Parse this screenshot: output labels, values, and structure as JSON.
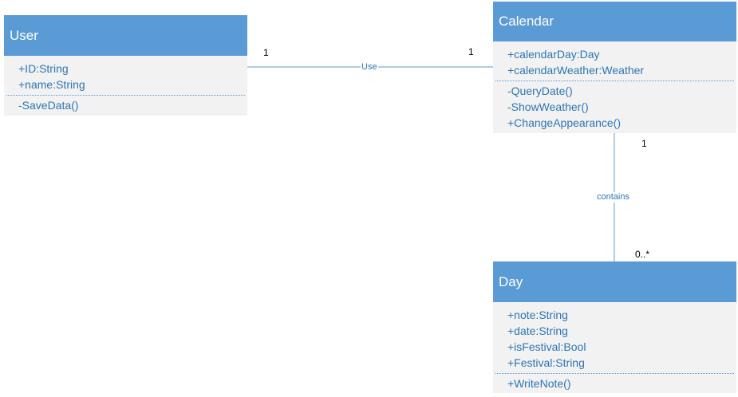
{
  "classes": {
    "user": {
      "name": "User",
      "attributes": [
        "+ID:String",
        "+name:String"
      ],
      "operations": [
        "-SaveData()"
      ]
    },
    "calendar": {
      "name": "Calendar",
      "attributes": [
        "+calendarDay:Day",
        "+calendarWeather:Weather"
      ],
      "operations": [
        "-QueryDate()",
        "-ShowWeather()",
        "+ChangeAppearance()"
      ]
    },
    "day": {
      "name": "Day",
      "attributes": [
        "+note:String",
        "+date:String",
        "+isFestival:Bool",
        "+Festival:String"
      ],
      "operations": [
        "+WriteNote()"
      ]
    }
  },
  "relations": {
    "use": {
      "label": "Use",
      "source_multiplicity": "1",
      "target_multiplicity": "1"
    },
    "contains": {
      "label": "contains",
      "source_multiplicity": "1",
      "target_multiplicity": "0..*"
    }
  },
  "colors": {
    "header": "#5b9bd5",
    "body": "#f2f2f2",
    "member_text": "#2e75b6",
    "connector": "#5b9bd5"
  }
}
